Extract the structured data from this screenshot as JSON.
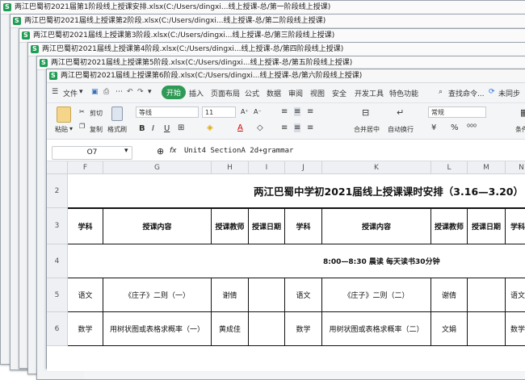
{
  "windows": [
    {
      "title": "两江巴蜀初2021届第1阶段线上授课安排.xlsx(C:/Users/dingxi...线上授课-总/第一阶段线上授课)"
    },
    {
      "title": "两江巴蜀初2021届线上授课第2阶段.xlsx(C:/Users/dingxi...线上授课-总/第二阶段线上授课)"
    },
    {
      "title": "两江巴蜀初2021届线上授课第3阶段.xlsx(C:/Users/dingxi...线上授课-总/第三阶段线上授课)"
    },
    {
      "title": "两江巴蜀初2021届线上授课第4阶段.xlsx(C:/Users/dingxi...线上授课-总/第四阶段线上授课)"
    },
    {
      "title": "两江巴蜀初2021届线上授课第5阶段.xlsx(C:/Users/dingxi...线上授课-总/第五阶段线上授课)"
    },
    {
      "title": "两江巴蜀初2021届线上授课第6阶段.xlsx(C:/Users/dingxi...线上授课-总/第六阶段线上授课)"
    }
  ],
  "menu": {
    "file": "文件",
    "items": [
      "开始",
      "插入",
      "页面布局",
      "公式",
      "数据",
      "审阅",
      "视图",
      "安全",
      "开发工具",
      "特色功能"
    ],
    "search": "查找命令...",
    "sync": "未同步"
  },
  "toolbar": {
    "paste": "粘贴",
    "cut": "剪切",
    "copy": "复制",
    "format_painter": "格式刷",
    "font": "等线",
    "size": "11",
    "merge": "合并居中",
    "wrap": "自动换行",
    "number_format": "常规",
    "conditional": "条件"
  },
  "formula_bar": {
    "cell_ref": "O7",
    "fx": "fx",
    "formula": "Unit4 SectionA 2d+grammar"
  },
  "sheet": {
    "columns": [
      "F",
      "G",
      "H",
      "I",
      "J",
      "K",
      "L",
      "M",
      "N"
    ],
    "rows": [
      "2",
      "3",
      "4",
      "5",
      "6"
    ],
    "title": "两江巴蜀中学初2021届线上授课课时安排（3.16—3.20）",
    "headers": [
      "学科",
      "授课内容",
      "授课教师",
      "授课日期",
      "学科",
      "授课内容",
      "授课教师",
      "授课日期",
      "学科"
    ],
    "morning": "8:00—8:30  晨读  每天读书30分钟",
    "row5": [
      "语文",
      "《庄子》二则（一）",
      "谢倩",
      "",
      "语文",
      "《庄子》二则（二）",
      "谢倩",
      "",
      "语文"
    ],
    "row6": [
      "数学",
      "用树状图或表格求概率（一）",
      "黄成佳",
      "",
      "数学",
      "用树状图或表格求概率（二）",
      "文娟",
      "",
      "数学"
    ]
  },
  "colors": {
    "accent": "#2e9a55",
    "excel_icon": "#1f9d55"
  }
}
